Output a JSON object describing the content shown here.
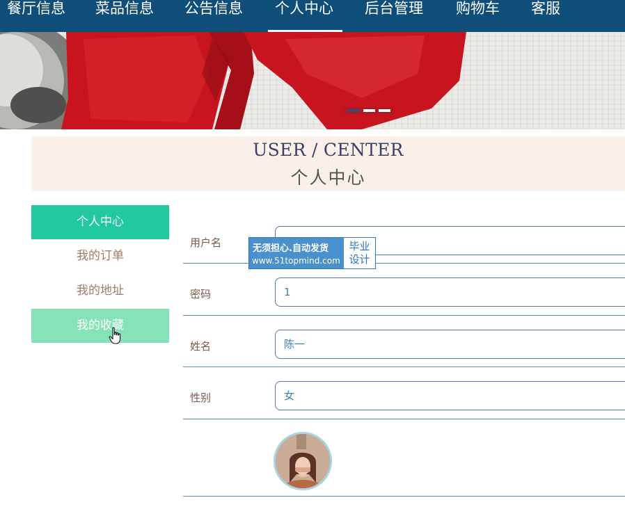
{
  "nav": {
    "items": [
      "餐厅信息",
      "菜品信息",
      "公告信息",
      "个人中心",
      "后台管理",
      "购物车",
      "客服"
    ],
    "active_index": 3
  },
  "banner": {
    "slide_count": 3,
    "active_slide": 0
  },
  "title": {
    "en": "USER / CENTER",
    "zh": "个人中心"
  },
  "side_menu": {
    "items": [
      "个人中心",
      "我的订单",
      "我的地址",
      "我的收藏"
    ],
    "active_index": 0,
    "hover_index": 3
  },
  "form": {
    "username_label": "用户名",
    "username_value": "",
    "password_label": "密码",
    "password_value": "1",
    "name_label": "姓名",
    "name_value": "陈一",
    "gender_label": "性别",
    "gender_value": "女"
  },
  "watermark": {
    "line1": "无须担心.自动发货",
    "line2": "www.51topmind.com",
    "badge_line1": "毕业",
    "badge_line2": "设计"
  },
  "icons": {
    "cursor": "hand-pointer-icon",
    "avatar": "user-avatar-photo"
  },
  "colors": {
    "nav_bg": "#0f4e78",
    "side_active": "#22c8a0",
    "side_hover": "#86e3b7",
    "title_band": "#fbefe9",
    "ribbon": "#c8141e"
  }
}
